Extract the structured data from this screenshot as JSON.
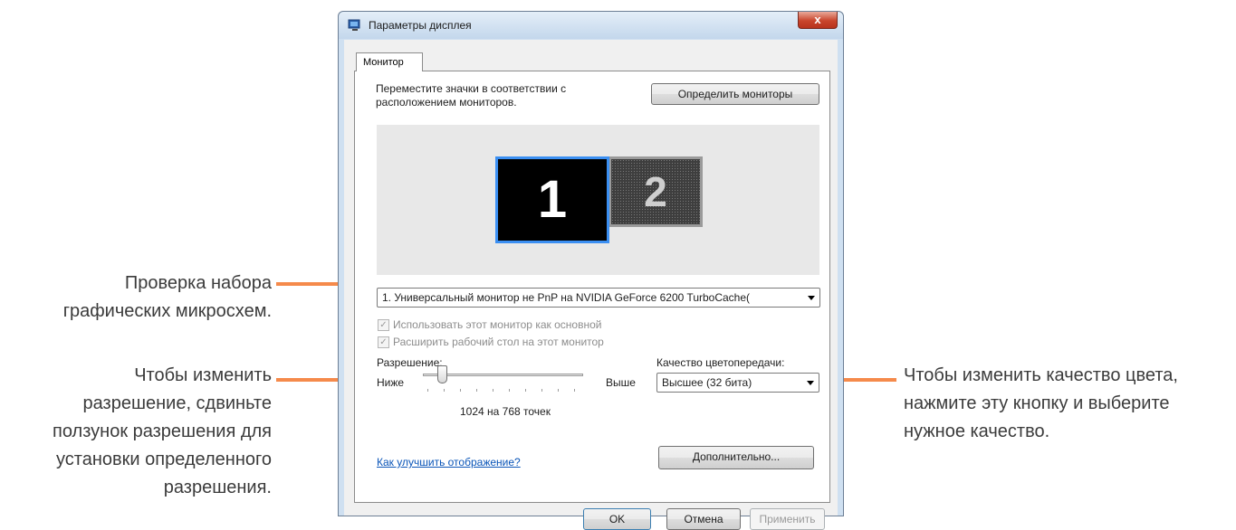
{
  "window": {
    "title": "Параметры дисплея",
    "close_glyph": "x"
  },
  "tab": {
    "label": "Монитор"
  },
  "instructions": {
    "line1": "Переместите значки в соответствии с",
    "line2": "расположением мониторов."
  },
  "identify_button": "Определить мониторы",
  "monitors": [
    {
      "number": "1",
      "selected": true
    },
    {
      "number": "2",
      "selected": false
    }
  ],
  "display_select": {
    "value": "1. Универсальный монитор не PnP на NVIDIA GeForce 6200 TurboCache("
  },
  "checkboxes": [
    {
      "label": "Использовать этот монитор как основной",
      "checked": true,
      "enabled": false
    },
    {
      "label": "Расширить рабочий стол на этот монитор",
      "checked": true,
      "enabled": false
    }
  ],
  "resolution": {
    "label": "Разрешение:",
    "low": "Ниже",
    "high": "Выше",
    "value": "1024 на 768 точек"
  },
  "color_quality": {
    "label": "Качество цветопередачи:",
    "value": "Высшее (32 бита)"
  },
  "help_link": "Как улучшить отображение?",
  "advanced_button": "Дополнительно...",
  "footer": {
    "ok": "OK",
    "cancel": "Отмена",
    "apply": "Применить"
  },
  "callouts": {
    "graphics_l1": "Проверка набора",
    "graphics_l2": "графических микросхем.",
    "resolution_l1": "Чтобы изменить",
    "resolution_l2": "разрешение, сдвиньте",
    "resolution_l3": "ползунок разрешения для",
    "resolution_l4": "установки определенного",
    "resolution_l5": "разрешения.",
    "color_l1": "Чтобы изменить качество цвета,",
    "color_l2": "нажмите эту кнопку и выберите",
    "color_l3": "нужное качество."
  },
  "colors": {
    "callout_line": "#f58a4b",
    "selected_monitor_border": "#3b8ff2",
    "link": "#0a55b8"
  }
}
